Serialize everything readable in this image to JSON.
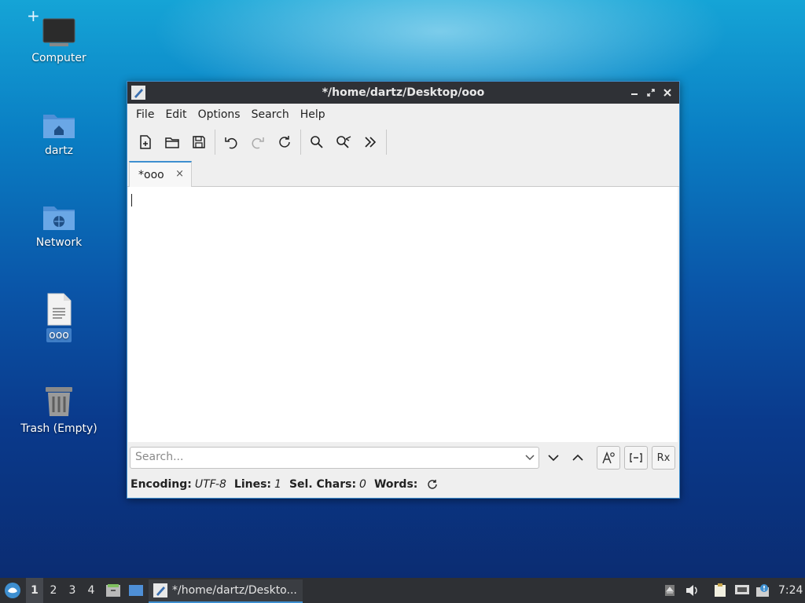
{
  "desktop": {
    "icons": [
      {
        "label": "Computer"
      },
      {
        "label": "dartz"
      },
      {
        "label": "Network"
      },
      {
        "label": "ooo"
      },
      {
        "label": "Trash (Empty)"
      }
    ]
  },
  "window": {
    "title": "*/home/dartz/Desktop/ooo",
    "menu": [
      "File",
      "Edit",
      "Options",
      "Search",
      "Help"
    ],
    "tab": {
      "label": "*ooo",
      "close_glyph": "×"
    },
    "search": {
      "placeholder": "Search...",
      "value": ""
    },
    "status": {
      "encoding_label": "Encoding:",
      "encoding_value": "UTF-8",
      "lines_label": "Lines:",
      "lines_value": "1",
      "selchars_label": "Sel. Chars:",
      "selchars_value": "0",
      "words_label": "Words:"
    },
    "opt_regex_label": "Rx"
  },
  "taskbar": {
    "workspaces": [
      "1",
      "2",
      "3",
      "4"
    ],
    "active_workspace": "1",
    "task_label": "*/home/dartz/Deskto...",
    "clock": "7:24"
  },
  "colors": {
    "accent": "#3e8fd0",
    "titlebar": "#2f3136",
    "taskbar": "#2e3034"
  }
}
